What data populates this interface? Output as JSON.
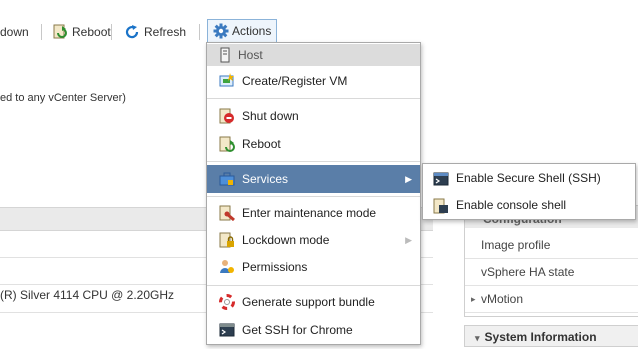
{
  "toolbar": {
    "shutdown_label": "down",
    "reboot_label": "Reboot",
    "refresh_label": "Refresh",
    "actions_label": "Actions"
  },
  "background": {
    "vcenter_text": "ed to any vCenter Server)",
    "cpu_text": "(R) Silver 4114 CPU @ 2.20GHz"
  },
  "right_panel": {
    "header": "Configuration",
    "items": [
      "Image profile",
      "vSphere HA state",
      "vMotion"
    ],
    "system_info": "System Information"
  },
  "menu": {
    "header": "Host",
    "items": [
      {
        "label": "Create/Register VM",
        "icon": "create-vm-icon"
      },
      {
        "label": "Shut down",
        "icon": "shutdown-icon"
      },
      {
        "label": "Reboot",
        "icon": "reboot-icon"
      },
      {
        "label": "Services",
        "icon": "services-icon"
      },
      {
        "label": "Enter maintenance mode",
        "icon": "maintenance-icon"
      },
      {
        "label": "Lockdown mode",
        "icon": "lockdown-icon"
      },
      {
        "label": "Permissions",
        "icon": "permissions-icon"
      },
      {
        "label": "Generate support bundle",
        "icon": "support-bundle-icon"
      },
      {
        "label": "Get SSH for Chrome",
        "icon": "ssh-chrome-icon"
      }
    ]
  },
  "submenu": {
    "items": [
      {
        "label": "Enable Secure Shell (SSH)",
        "icon": "ssh-icon"
      },
      {
        "label": "Enable console shell",
        "icon": "console-icon"
      }
    ]
  },
  "colors": {
    "menu_highlight": "#5a7ea8",
    "accent_blue": "#1a73c8"
  }
}
